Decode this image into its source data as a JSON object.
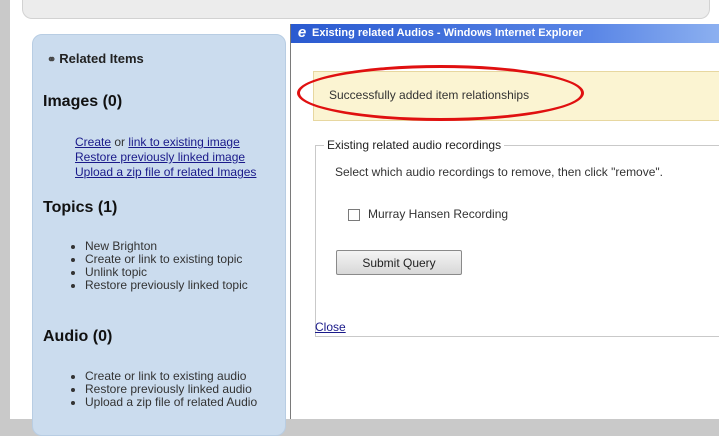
{
  "sidebar": {
    "heading": "Related Items",
    "images": {
      "title": "Images (0)",
      "create": "Create",
      "or": " or ",
      "link_existing": "link to existing image",
      "restore": "Restore previously linked image",
      "upload": "Upload a zip file of related Images"
    },
    "topics": {
      "title": "Topics (1)",
      "items": [
        "New Brighton",
        "Create or link to existing topic",
        "Unlink topic",
        "Restore previously linked topic"
      ]
    },
    "audio": {
      "title": "Audio (0)",
      "items": [
        "Create or link to existing audio",
        "Restore previously linked audio",
        "Upload a zip file of related Audio"
      ]
    }
  },
  "popup": {
    "title": "Existing related Audios - Windows Internet Explorer",
    "success_message": "Successfully added item relationships",
    "fieldset_legend": "Existing related audio recordings",
    "instruction": "Select which audio recordings to remove, then click \"remove\".",
    "recordings": [
      {
        "label": "Murray Hansen Recording",
        "checked": false
      }
    ],
    "submit_label": "Submit Query",
    "close_label": "Close"
  },
  "colors": {
    "annotation": "#e01010",
    "success_bg": "#fbf4d2",
    "sidebar_bg": "#cbdcee",
    "titlebar": "#2a5ad0"
  }
}
